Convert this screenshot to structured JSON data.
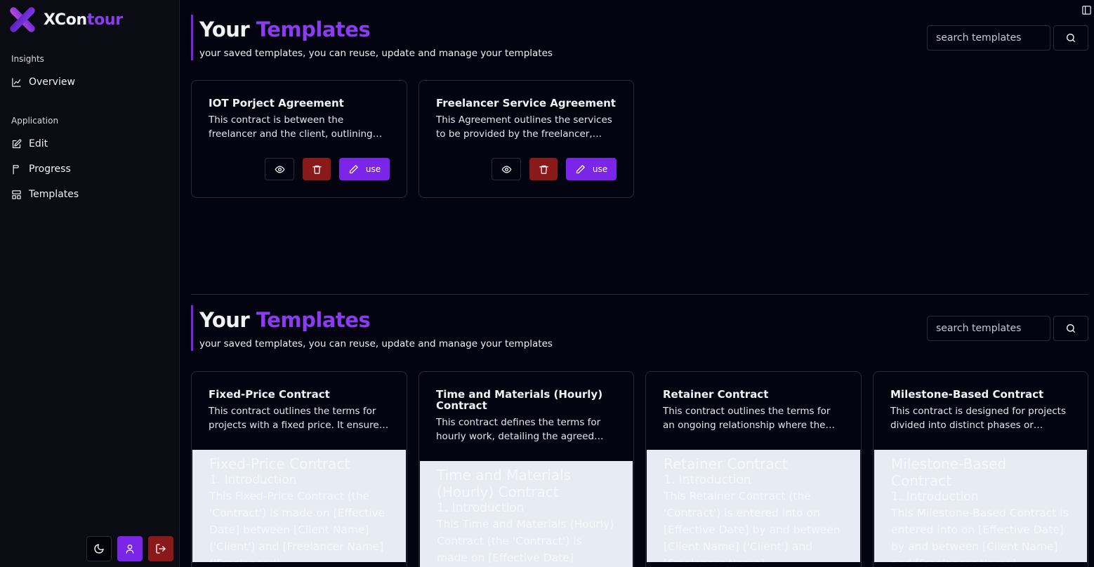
{
  "brand": {
    "name_part1": "XCon",
    "name_part2": "tour"
  },
  "sidebar": {
    "sections": [
      {
        "label": "Insights"
      },
      {
        "label": "Application"
      }
    ],
    "items": [
      {
        "label": "Overview",
        "icon": "chart-line-icon"
      },
      {
        "label": "Edit",
        "icon": "edit-icon"
      },
      {
        "label": "Progress",
        "icon": "flag-icon"
      },
      {
        "label": "Templates",
        "icon": "layout-icon"
      }
    ],
    "bottom_buttons": [
      "moon-icon",
      "user-icon",
      "logout-icon"
    ]
  },
  "saved": {
    "title_part1": "Your",
    "title_part2": "Templates",
    "subtitle": "your saved templates, you can reuse, update and manage your templates",
    "search_placeholder": "search templates",
    "cards": [
      {
        "title": "IOT Porject Agreement",
        "desc": "This contract is between the freelancer and the client, outlining the terms of the IOT project",
        "use_label": "use"
      },
      {
        "title": "Freelancer Service Agreement",
        "desc": "This Agreement outlines the services to be provided by the freelancer, payment terms and obligations",
        "use_label": "use"
      }
    ]
  },
  "library": {
    "title_part1": "Your",
    "title_part2": "Templates",
    "subtitle": "your saved templates, you can reuse, update and manage your templates",
    "search_placeholder": "search templates",
    "cards": [
      {
        "title": "Fixed-Price Contract",
        "desc": "This contract outlines the terms for projects with a fixed price. It ensures clarity of scope",
        "pv_title": "Fixed-Price Contract",
        "pv_sub": "1. Introduction",
        "pv_body": "This Fixed-Price Contract (the 'Contract') is made on [Effective Date] between [Client Name] ('Client') and [Freelancer Name] ('Freelancer')."
      },
      {
        "title": "Time and Materials (Hourly) Contract",
        "desc": "This contract defines the terms for hourly work, detailing the agreed hourly rate",
        "pv_title": "Time and Materials (Hourly) Contract",
        "pv_sub": "1. Introduction",
        "pv_body": "This Time and Materials (Hourly) Contract (the 'Contract') is made on [Effective Date] between [Client Name]"
      },
      {
        "title": "Retainer Contract",
        "desc": "This contract outlines the terms for an ongoing relationship where the client pays a retainer",
        "pv_title": "Retainer Contract",
        "pv_sub": "1. Introduction",
        "pv_body": "This Retainer Contract (the 'Contract') is entered into on [Effective Date] by and between [Client Name] ('Client') and [Freelancer Name]"
      },
      {
        "title": "Milestone-Based Contract",
        "desc": "This contract is designed for projects divided into distinct phases or milestones",
        "pv_title": "Milestone-Based Contract",
        "pv_sub": "1. Introduction",
        "pv_body": "This Milestone-Based Contract is entered into on [Effective Date] by and between [Client Name] and [Freelancer Name]"
      }
    ]
  }
}
